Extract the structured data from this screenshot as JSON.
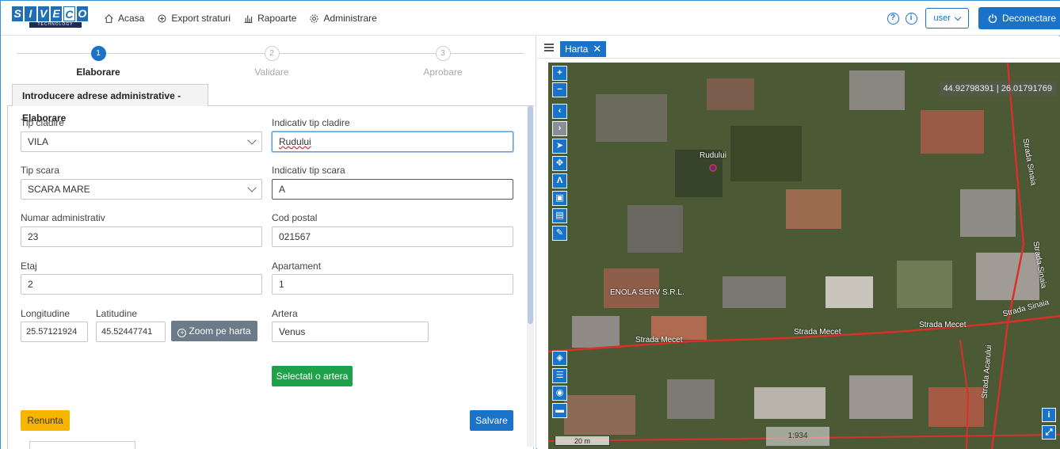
{
  "header": {
    "logo_text": "SIVECO",
    "logo_sub": "TECHNOLOGY",
    "nav": [
      {
        "label": "Acasa",
        "icon": "home-icon"
      },
      {
        "label": "Export straturi",
        "icon": "layers-export-icon"
      },
      {
        "label": "Rapoarte",
        "icon": "bar-chart-icon"
      },
      {
        "label": "Administrare",
        "icon": "gear-icon"
      }
    ],
    "help_icon": "?",
    "info_icon": "i",
    "user_label": "user",
    "logout_label": "Deconectare"
  },
  "stepper": {
    "steps": [
      {
        "num": "1",
        "label": "Elaborare",
        "active": true
      },
      {
        "num": "2",
        "label": "Validare",
        "active": false
      },
      {
        "num": "3",
        "label": "Aprobare",
        "active": false
      }
    ]
  },
  "form": {
    "title": "Introducere adrese administrative - Elaborare",
    "tip_cladire": {
      "label": "Tip cladire",
      "value": "VILA"
    },
    "indicativ_tip_cladire": {
      "label": "Indicativ tip cladire",
      "value": "Rudului"
    },
    "tip_scara": {
      "label": "Tip scara",
      "value": "SCARA MARE"
    },
    "indicativ_tip_scara": {
      "label": "Indicativ tip scara",
      "value": "A"
    },
    "numar_administrativ": {
      "label": "Numar administrativ",
      "value": "23"
    },
    "cod_postal": {
      "label": "Cod postal",
      "value": "021567"
    },
    "etaj": {
      "label": "Etaj",
      "value": "2"
    },
    "apartament": {
      "label": "Apartament",
      "value": "1"
    },
    "longitudine": {
      "label": "Longitudine",
      "value": "25.57121924"
    },
    "latitudine": {
      "label": "Latitudine",
      "value": "45.52447741"
    },
    "zoom_button": "Zoom pe harta",
    "artera": {
      "label": "Artera",
      "value": "Venus"
    },
    "select_artera_button": "Selectati o artera",
    "cancel_button": "Renunta",
    "save_button": "Salvare"
  },
  "map": {
    "tab_label": "Harta",
    "coords": "44.92798391 | 26.01791769",
    "marker_label": "Rudului",
    "poi_label": "ENOLA SERV S.R.L.",
    "street_labels": [
      "Strada Mecet",
      "Strada Mecet",
      "Strada Mecet",
      "Strada Sinaia",
      "Strada Sinaia",
      "Strada Sinaia",
      "Strada Acarului"
    ],
    "scale": "20 m",
    "ratio": "1:934",
    "info_button": "i"
  }
}
